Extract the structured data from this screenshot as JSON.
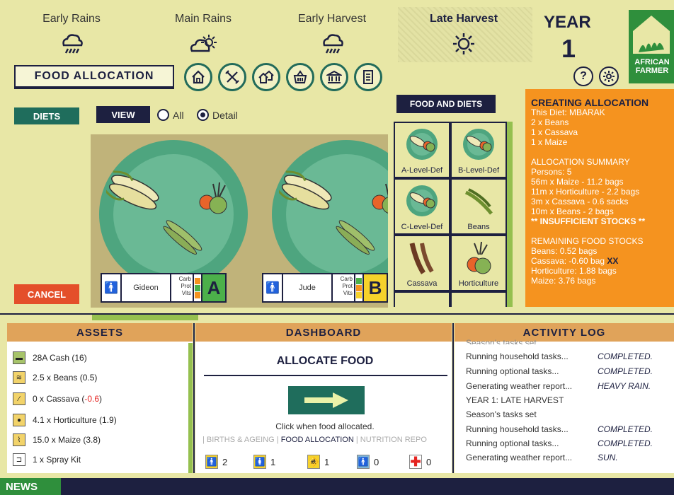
{
  "seasons": [
    {
      "label": "Early Rains",
      "weather": "rain-cloud-icon"
    },
    {
      "label": "Main Rains",
      "weather": "sun-cloud-icon"
    },
    {
      "label": "Early Harvest",
      "weather": "rain-cloud-icon"
    },
    {
      "label": "Late Harvest",
      "weather": "sun-icon",
      "current": true
    }
  ],
  "year": {
    "label": "YEAR",
    "value": "1"
  },
  "logo": {
    "line1": "AFRICAN",
    "line2": "FARMER"
  },
  "help_label": "?",
  "screen_title": "FOOD ALLOCATION",
  "nav_icons": [
    "home-icon",
    "farm-tools-icon",
    "village-icon",
    "market-basket-icon",
    "bank-icon",
    "report-icon"
  ],
  "diets_button": "DIETS",
  "view_button": "VIEW",
  "view_options": [
    {
      "label": "All",
      "selected": false
    },
    {
      "label": "Detail",
      "selected": true
    }
  ],
  "plates": [
    {
      "person": "Gideon",
      "grade": "A",
      "nutrients": [
        "Carb",
        "Prot",
        "Vits"
      ]
    },
    {
      "person": "Jude",
      "grade": "B",
      "nutrients": [
        "Carb",
        "Prot",
        "Vits"
      ]
    }
  ],
  "cancel_label": "CANCEL",
  "food_diets": {
    "title": "FOOD AND DIETS",
    "items": [
      "A-Level-Def",
      "B-Level-Def",
      "C-Level-Def",
      "Beans",
      "Cassava",
      "Horticulture"
    ]
  },
  "allocation": {
    "title": "CREATING ALLOCATION",
    "diet_line": "This Diet: MBARAK",
    "diet_items": [
      "2 x Beans",
      "1 x Cassava",
      "1 x Maize"
    ],
    "summary_title": "ALLOCATION SUMMARY",
    "summary_items": [
      "Persons: 5",
      "56m x Maize - 11.2 bags",
      "11m x Horticulture - 2.2 bags",
      "3m x Cassava - 0.6 sacks",
      "10m x Beans - 2 bags"
    ],
    "warning": "** INSUFFICIENT STOCKS **",
    "remaining_title": "REMAINING FOOD STOCKS",
    "remaining_beans": "Beans: 0.52 bags",
    "remaining_cassava": "Cassava: -0.60 bag",
    "remaining_cassava_flag": "XX",
    "remaining_hort": "Horticulture: 1.88 bags",
    "remaining_maize": "Maize: 3.76 bags"
  },
  "assets": {
    "title": "ASSETS",
    "items": [
      {
        "icon": "cash-icon",
        "label": "28A Cash (16)"
      },
      {
        "icon": "beans-icon",
        "label": "2.5 x Beans (0.5)"
      },
      {
        "icon": "cassava-icon",
        "label_main": "0 x Cassava (",
        "label_neg": "-0.6",
        "label_end": ")"
      },
      {
        "icon": "horticulture-icon",
        "label": "4.1 x Horticulture (1.9)"
      },
      {
        "icon": "maize-icon",
        "label": "15.0 x Maize (3.8)"
      },
      {
        "icon": "spray-kit-icon",
        "label": "1 x Spray Kit"
      }
    ]
  },
  "dashboard": {
    "title": "DASHBOARD",
    "action_title": "ALLOCATE FOOD",
    "note": "Click when food allocated.",
    "links": [
      "BIRTHS & AGEING",
      "FOOD ALLOCATION",
      "NUTRITION REPO"
    ],
    "stats": [
      {
        "icon": "male-figure-icon",
        "value": "2",
        "color": "#f6d22b"
      },
      {
        "icon": "female-figure-icon",
        "value": "1",
        "color": "#f6d22b"
      },
      {
        "icon": "child-figure-icon",
        "value": "1",
        "color": "#f6d22b"
      },
      {
        "icon": "sick-figure-icon",
        "value": "0",
        "color": "#7fb4d8"
      },
      {
        "icon": "medical-cross-icon",
        "value": "0",
        "color": "#ffffff"
      }
    ]
  },
  "activity_log": {
    "title": "ACTIVITY LOG",
    "lines": [
      {
        "text": "Season's tasks set",
        "result": ""
      },
      {
        "text": "Running household tasks...",
        "result": "COMPLETED."
      },
      {
        "text": "Running optional tasks...",
        "result": "COMPLETED."
      },
      {
        "text": "Generating weather report...",
        "result": "HEAVY RAIN."
      },
      {
        "text": "YEAR 1: LATE HARVEST",
        "result": ""
      },
      {
        "text": "Season's tasks set",
        "result": ""
      },
      {
        "text": "Running household tasks...",
        "result": "COMPLETED."
      },
      {
        "text": "Running optional tasks...",
        "result": "COMPLETED."
      },
      {
        "text": "Generating weather report...",
        "result": "SUN."
      }
    ]
  },
  "news_label": "NEWS"
}
